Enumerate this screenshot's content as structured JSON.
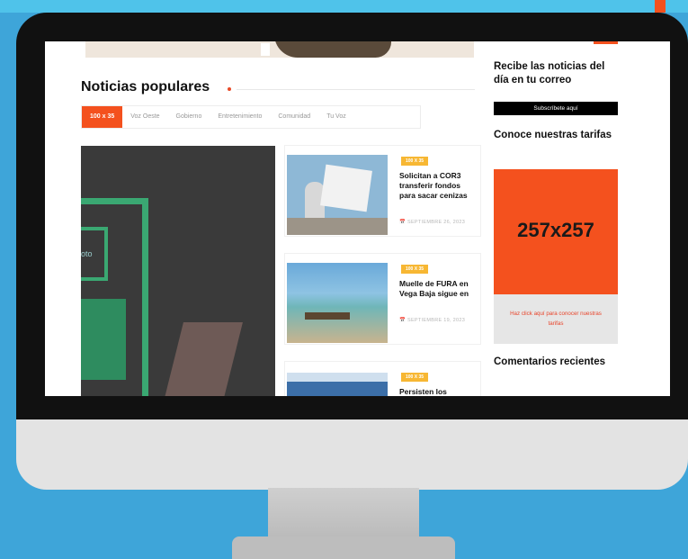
{
  "colors": {
    "background": "#3ea5d9",
    "accent": "#f4511e",
    "category_badge": "#f7b733",
    "bezel": "#111111"
  },
  "popular": {
    "title": "Noticias populares",
    "tabs": [
      {
        "label": "100 x 35",
        "active": true
      },
      {
        "label": "Voz Oeste",
        "active": false
      },
      {
        "label": "Gobierno",
        "active": false
      },
      {
        "label": "Entretenimiento",
        "active": false
      },
      {
        "label": "Comunidad",
        "active": false
      },
      {
        "label": "Tu Voz",
        "active": false
      }
    ],
    "feature_fragment": "oto",
    "articles": [
      {
        "category": "100 X 35",
        "headline": "Solicitan a COR3 transferir fondos para sacar cenizas",
        "date": "SEPTIEMBRE 26, 2023",
        "date_icon": "calendar-icon"
      },
      {
        "category": "100 X 35",
        "headline": "Muelle de FURA en Vega Baja sigue en",
        "date": "SEPTIEMBRE 19, 2023",
        "date_icon": "calendar-icon"
      },
      {
        "category": "100 X 35",
        "headline": "Persisten los",
        "date": "",
        "date_icon": "calendar-icon"
      }
    ]
  },
  "sidebar": {
    "newsletter_title": "Recibe las noticias del día en tu correo",
    "subscribe_label": "Subscríbete aquí",
    "rates_title": "Conoce nuestras tarifas",
    "ad_size": "257x257",
    "ad_link": "Haz click aquí para conocer nuestras tarifas",
    "comments_title": "Comentarios recientes"
  }
}
